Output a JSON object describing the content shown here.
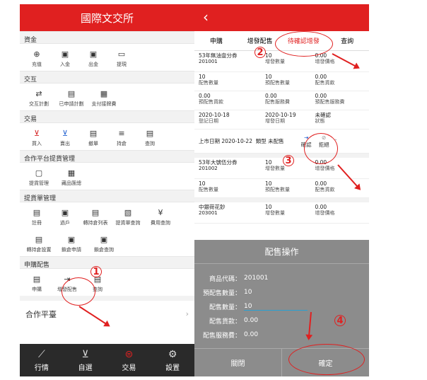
{
  "left": {
    "title": "國際文交所",
    "sections": [
      {
        "name": "資金",
        "items": [
          {
            "label": "充值",
            "icon": "deposit-icon",
            "glyph": "⊕"
          },
          {
            "label": "入金",
            "icon": "deposit-in-icon",
            "glyph": "▣"
          },
          {
            "label": "出金",
            "icon": "withdraw-icon",
            "glyph": "▣"
          },
          {
            "label": "提現",
            "icon": "cash-icon",
            "glyph": "▭"
          }
        ]
      },
      {
        "name": "交互",
        "items": [
          {
            "label": "交互計劃",
            "icon": "transfer-icon",
            "glyph": "⇄"
          },
          {
            "label": "已申請計劃",
            "icon": "applied-plan-icon",
            "glyph": "▤"
          },
          {
            "label": "支付接牌費",
            "icon": "pay-fee-icon",
            "glyph": "▦"
          }
        ]
      },
      {
        "name": "交易",
        "items": [
          {
            "label": "買入",
            "icon": "buy-icon",
            "glyph": "⊻",
            "color": "red"
          },
          {
            "label": "賣出",
            "icon": "sell-icon",
            "glyph": "⊻",
            "color": "blue"
          },
          {
            "label": "撤單",
            "icon": "cancel-order-icon",
            "glyph": "▤"
          },
          {
            "label": "持倉",
            "icon": "position-icon",
            "glyph": "≡"
          },
          {
            "label": "查詢",
            "icon": "query-icon",
            "glyph": "▤"
          }
        ]
      },
      {
        "name": "合作平台提貨管理",
        "items": [
          {
            "label": "提貨管理",
            "icon": "pickup-icon",
            "glyph": "▢"
          },
          {
            "label": "藏品匯總",
            "icon": "collection-icon",
            "glyph": "▦"
          }
        ]
      },
      {
        "name": "提貨單管理",
        "items": [
          {
            "label": "註冊",
            "icon": "register-icon",
            "glyph": "▤"
          },
          {
            "label": "過戶",
            "icon": "transfer-owner-icon",
            "glyph": "▣"
          },
          {
            "label": "轉持倉列表",
            "icon": "position-list-icon",
            "glyph": "▤"
          },
          {
            "label": "提貨單查詢",
            "icon": "bill-query-icon",
            "glyph": "▧"
          },
          {
            "label": "費用查詢",
            "icon": "fee-query-icon",
            "glyph": "¥"
          },
          {
            "label": "轉持倉設置",
            "icon": "position-setting-icon",
            "glyph": "▤"
          },
          {
            "label": "鎖倉申請",
            "icon": "lock-apply-icon",
            "glyph": "▣"
          },
          {
            "label": "鎖倉查詢",
            "icon": "lock-query-icon",
            "glyph": "▣"
          }
        ]
      },
      {
        "name": "申購配售",
        "items": [
          {
            "label": "申購",
            "icon": "subscribe-icon",
            "glyph": "▤"
          },
          {
            "label": "增發配售",
            "icon": "placement-icon",
            "glyph": "⇥"
          },
          {
            "label": "查詢",
            "icon": "query-icon",
            "glyph": "▤"
          }
        ]
      }
    ],
    "partner": "合作平臺",
    "tabs": [
      "行情",
      "自選",
      "交易",
      "設置"
    ]
  },
  "right": {
    "tabs": [
      "申購",
      "增發配售",
      "待確認增發",
      "查詢"
    ],
    "rec1": {
      "name": "53年無油壹分券",
      "code": "201001",
      "f1": "10",
      "f1k": "增發數量",
      "f2": "0.00",
      "f2k": "增發價格",
      "g0": "10",
      "g0k": "配售數量",
      "g1": "10",
      "g1k": "預配售數量",
      "g2": "0.00",
      "g2k": "配售貨款",
      "h0": "0.00",
      "h0k": "預配售貨款",
      "h1": "0.00",
      "h1k": "配售服務費",
      "h2": "0.00",
      "h2k": "預配售服務費",
      "i0": "2020-10-18",
      "i0k": "登記日期",
      "i1": "2020-10-19",
      "i1k": "增發日期",
      "i2": "未確認",
      "i2k": "狀態",
      "listing_label": "上市日期",
      "listing": "2020-10-22",
      "type_label": "類型",
      "type": "未配售",
      "confirm": "確認",
      "reject": "拒絕"
    },
    "rec2": {
      "name": "53年大號伍分券",
      "code": "201002",
      "f1": "10",
      "f1k": "增發數量",
      "f2": "0.00",
      "f2k": "增發價格",
      "g0": "10",
      "g0k": "配售數量",
      "g1": "10",
      "g1k": "預配售數量",
      "g2": "0.00",
      "g2k": "配售貨款"
    },
    "rec3": {
      "name": "中銀荷花鈔",
      "code": "203001",
      "f1": "10",
      "f1k": "增發數量",
      "f2": "0.00",
      "f2k": "增發價格",
      "g0": "10",
      "g1": "10"
    },
    "dialog": {
      "title": "配售操作",
      "lines": [
        {
          "k": "商品代碼：",
          "v": "201001"
        },
        {
          "k": "預配售數量：",
          "v": "10"
        },
        {
          "k": "配售數量：",
          "v": "10"
        },
        {
          "k": "配售貨款：",
          "v": "0.00"
        },
        {
          "k": "配售服務費：",
          "v": "0.00"
        }
      ],
      "close": "關閉",
      "ok": "確定"
    }
  },
  "markers": [
    "1",
    "2",
    "3",
    "4"
  ]
}
